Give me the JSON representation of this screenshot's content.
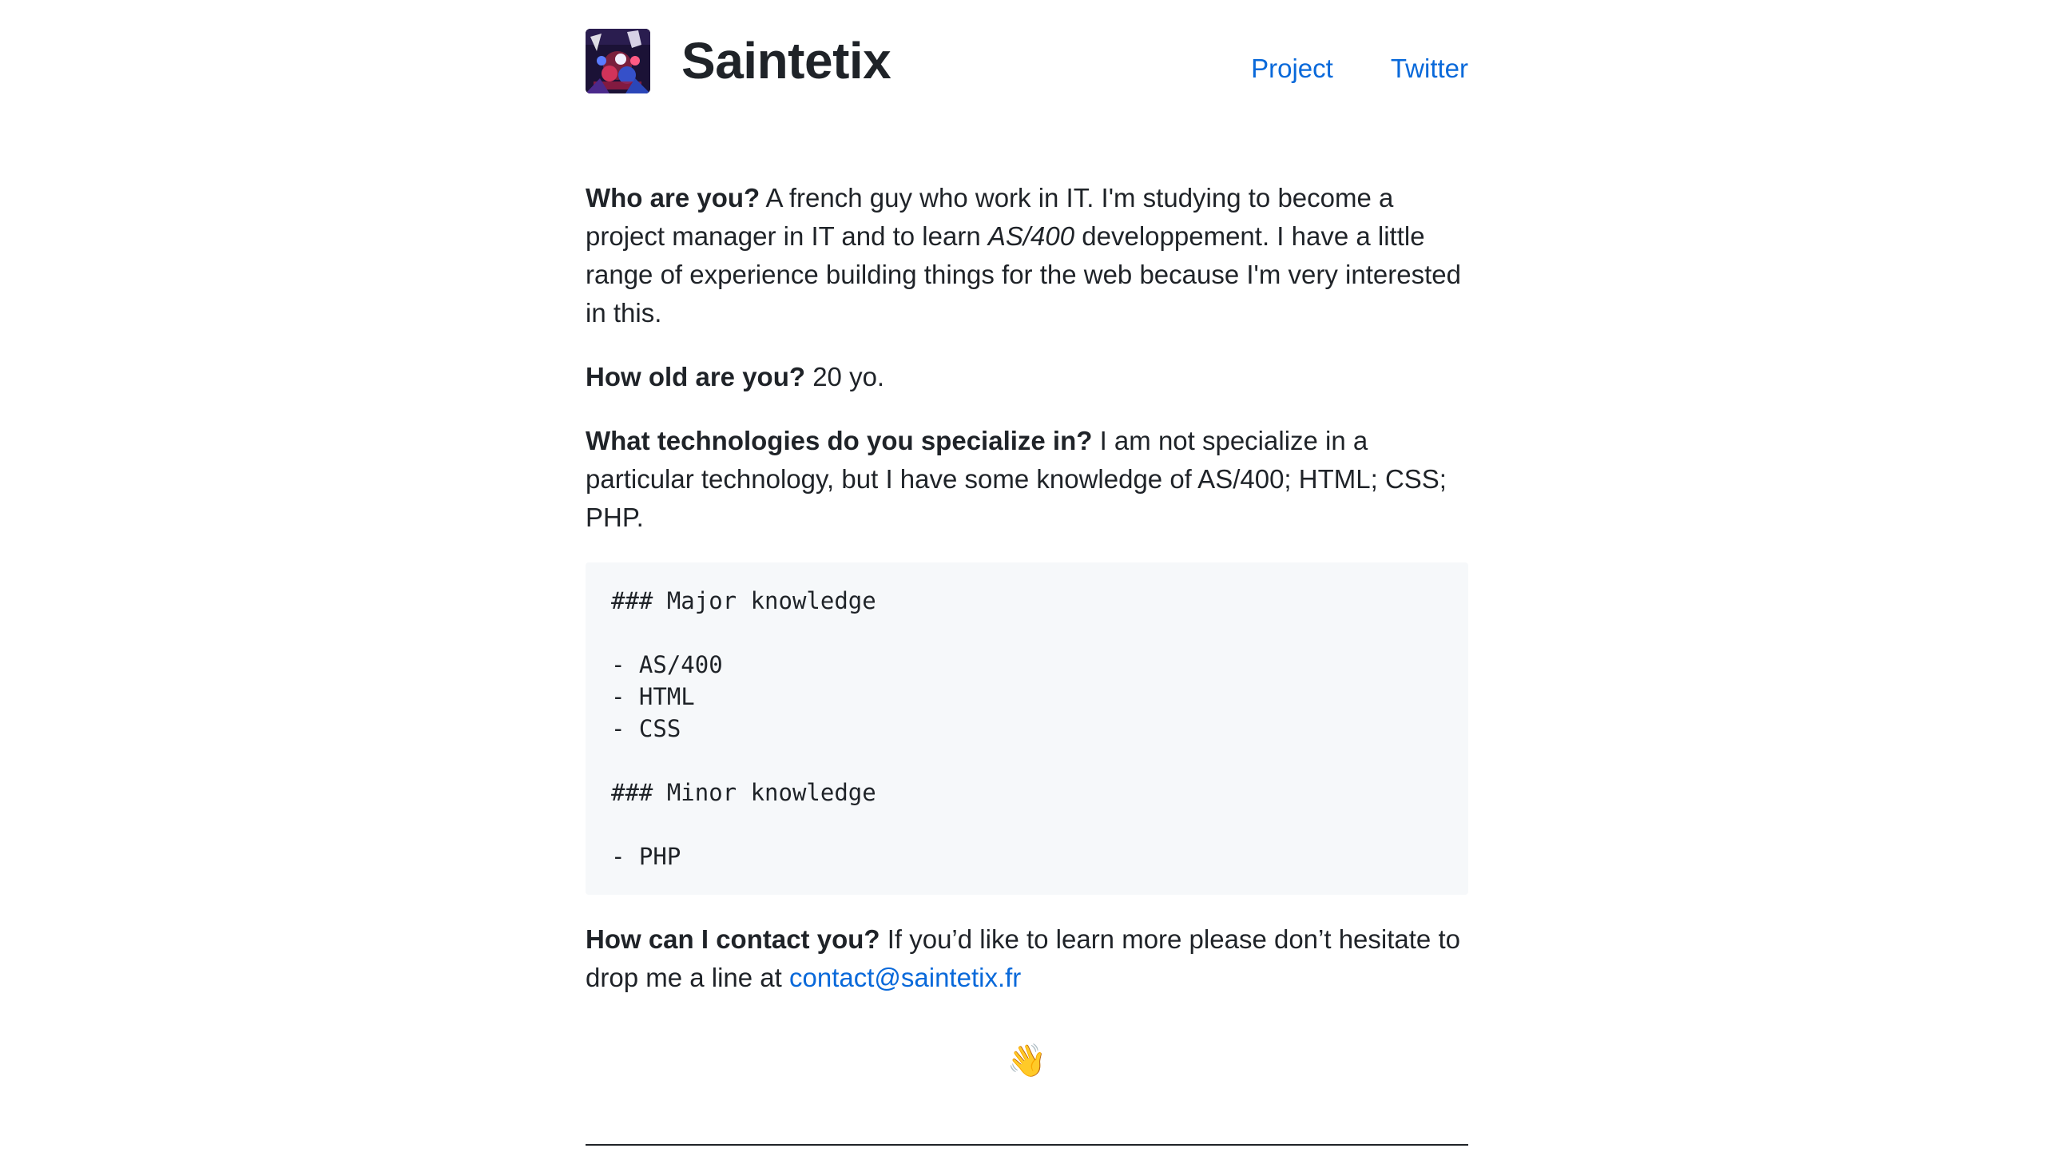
{
  "header": {
    "site_title": "Saintetix",
    "nav": [
      {
        "label": "Project"
      },
      {
        "label": "Twitter"
      }
    ]
  },
  "about": {
    "q1": {
      "question": "Who are you?",
      "answer_before": " A french guy who work in IT. I'm studying to become a project manager in IT and to learn ",
      "answer_em": "AS/400",
      "answer_after": " developpement. I have a little range of experience building things for the web because I'm very interested in this."
    },
    "q2": {
      "question": "How old are you?",
      "answer": " 20 yo."
    },
    "q3": {
      "question": "What technologies do you specialize in?",
      "answer": " I am not specialize in a particular technology, but I have some knowledge of AS/400; HTML; CSS; PHP."
    },
    "code": "### Major knowledge\n\n- AS/400\n- HTML\n- CSS\n\n### Minor knowledge\n\n- PHP",
    "q4": {
      "question": "How can I contact you?",
      "answer": " If you’d like to learn more please don’t hesitate to drop me a line at ",
      "email": "contact@saintetix.fr"
    },
    "footer_emoji": "👋"
  },
  "colors": {
    "link": "#0969da",
    "text": "#1f2328",
    "code_bg": "#f6f8fa"
  }
}
